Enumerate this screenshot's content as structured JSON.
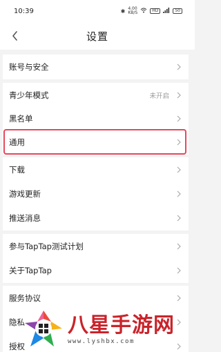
{
  "status_bar": {
    "time": "10:39",
    "icons": [
      "bluetooth-icon",
      "network-speed-icon",
      "wifi-icon",
      "hd-icon",
      "signal-icon",
      "battery-icon"
    ],
    "speed": "4.00\nKB/S",
    "battery": "50"
  },
  "header": {
    "title": "设置",
    "back_icon": "chevron-left-icon"
  },
  "settings": {
    "account_security": "账号与安全",
    "teen_mode": "青少年模式",
    "teen_mode_value": "未开启",
    "blacklist": "黑名单",
    "general": "通用",
    "download": "下载",
    "game_updates": "游戏更新",
    "push_messages": "推送消息",
    "test_plan": "参与TapTap测试计划",
    "about": "关于TapTap",
    "service_agreement": "服务协议",
    "privacy": "隐私",
    "authorization": "授权"
  },
  "colors": {
    "highlight": "#e8465a",
    "watermark_red": "#c9242b"
  },
  "watermark": {
    "title": "八星手游网",
    "url": "www.lyshbx.com"
  }
}
